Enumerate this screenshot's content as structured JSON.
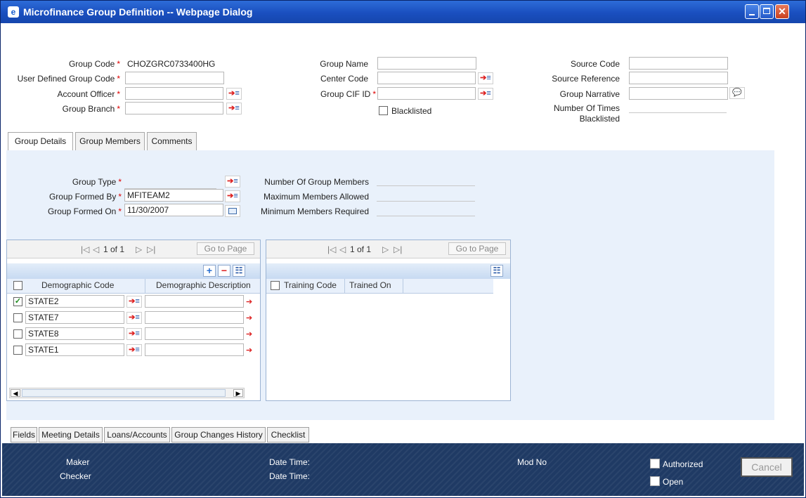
{
  "window": {
    "title": "Microfinance Group Definition -- Webpage Dialog",
    "app_icon": "ie-icon",
    "close_glyph": "✕"
  },
  "header": {
    "group_code_label": "Group Code",
    "group_code_value": "CHOZGRC0733400HG",
    "user_defined_group_code_label": "User Defined Group Code",
    "account_officer_label": "Account Officer",
    "group_branch_label": "Group Branch",
    "group_name_label": "Group Name",
    "center_code_label": "Center Code",
    "group_cif_id_label": "Group CIF ID",
    "blacklisted_label": "Blacklisted",
    "source_code_label": "Source Code",
    "source_reference_label": "Source Reference",
    "group_narrative_label": "Group Narrative",
    "number_of_times_label_1": "Number Of Times",
    "number_of_times_label_2": "Blacklisted",
    "required_mark": "*"
  },
  "tabs": [
    {
      "label": "Group Details"
    },
    {
      "label": "Group Members"
    },
    {
      "label": "Comments"
    }
  ],
  "details": {
    "group_type_label": "Group Type",
    "group_formed_by_label": "Group Formed By",
    "group_formed_by_value": "MFITEAM2",
    "group_formed_on_label": "Group Formed On",
    "group_formed_on_value": "11/30/2007",
    "number_of_group_members_label": "Number Of Group Members",
    "maximum_members_allowed_label": "Maximum Members Allowed",
    "minimum_members_required_label": "Minimum Members Required"
  },
  "demographic_grid": {
    "pager": "1 of  1",
    "first": "|◁",
    "prev": "◁",
    "next": "▷",
    "last": "▷|",
    "goto_label": "Go to Page",
    "add_glyph": "+",
    "remove_glyph": "−",
    "view_glyph": "☷",
    "columns": [
      "Demographic Code",
      "Demographic Description"
    ],
    "rows": [
      {
        "code": "STATE2",
        "checked": "✓"
      },
      {
        "code": "STATE7",
        "checked": ""
      },
      {
        "code": "STATE8",
        "checked": ""
      },
      {
        "code": "STATE1",
        "checked": ""
      }
    ],
    "scroll_left": "◀",
    "scroll_right": "▶"
  },
  "training_grid": {
    "pager": "1 of  1",
    "first": "|◁",
    "prev": "◁",
    "next": "▷",
    "last": "▷|",
    "goto_label": "Go to Page",
    "view_glyph": "☷",
    "columns": [
      "Training Code",
      "Trained On"
    ]
  },
  "bottom_tabs": [
    {
      "label": "Fields"
    },
    {
      "label": "Meeting Details"
    },
    {
      "label": "Loans/Accounts"
    },
    {
      "label": "Group Changes History"
    },
    {
      "label": "Checklist"
    }
  ],
  "footer": {
    "maker_label": "Maker",
    "checker_label": "Checker",
    "date_time_label_1": "Date Time:",
    "date_time_label_2": "Date Time:",
    "mod_no_label": "Mod No",
    "authorized_label": "Authorized",
    "open_label": "Open",
    "cancel_label": "Cancel"
  },
  "colors": {
    "titlebar": "#1a4fbf",
    "panel": "#e9f1fb",
    "footer": "#1f3a64",
    "required": "#dd0000"
  }
}
